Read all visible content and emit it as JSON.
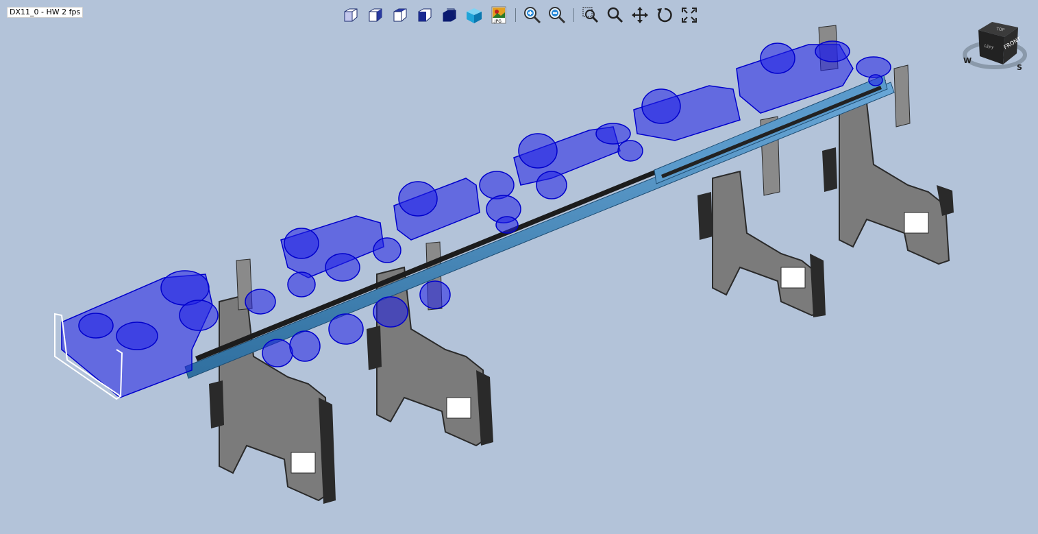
{
  "app": {
    "status_overlay": "DX11_0 - HW 2 fps",
    "background_color": "#b3c3d9"
  },
  "toolbar": {
    "view_buttons": [
      {
        "icon": "view-cube-1-icon"
      },
      {
        "icon": "view-cube-2-icon"
      },
      {
        "icon": "view-cube-3-icon"
      },
      {
        "icon": "view-cube-solid-icon"
      },
      {
        "icon": "view-cube-dark-icon"
      },
      {
        "icon": "view-cube-shaded-icon"
      },
      {
        "icon": "export-jpg-icon",
        "label": ".JPG"
      }
    ],
    "zoom_buttons": [
      {
        "icon": "zoom-in-icon"
      },
      {
        "icon": "zoom-out-icon"
      }
    ],
    "nav_buttons": [
      {
        "icon": "zoom-window-icon"
      },
      {
        "icon": "zoom-icon"
      },
      {
        "icon": "pan-icon"
      },
      {
        "icon": "rotate-icon"
      },
      {
        "icon": "fit-all-icon"
      }
    ]
  },
  "navcube": {
    "front_label": "FRONT",
    "top_label": "TOP",
    "left_label": "LEFT",
    "compass": [
      "W",
      "S"
    ]
  },
  "model": {
    "colors": {
      "frame_gray": "#7b7b7b",
      "frame_dark": "#2a2a2a",
      "rail_blue": "#4a8ec2",
      "selection_blue": "#1a1aee",
      "highlight_white": "#ffffff"
    },
    "frame_count": 4,
    "carriage_count": 6
  }
}
